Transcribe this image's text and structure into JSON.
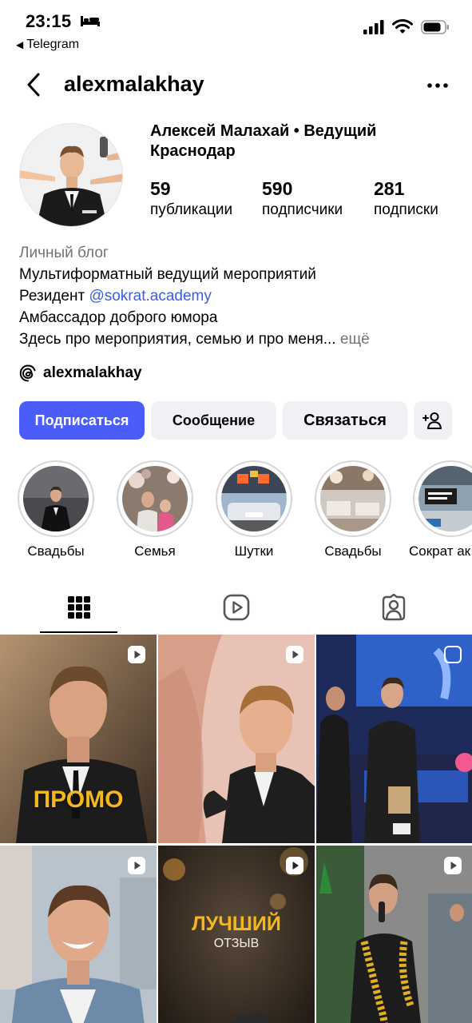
{
  "status": {
    "time": "23:15",
    "back_app": "Telegram"
  },
  "header": {
    "username": "alexmalakhay"
  },
  "profile": {
    "full_name": "Алексей Малахай • Ведущий Краснодар",
    "stats": [
      {
        "value": "59",
        "label": "публикации"
      },
      {
        "value": "590",
        "label": "подписчики"
      },
      {
        "value": "281",
        "label": "подписки"
      }
    ],
    "bio": {
      "category": "Личный блог",
      "line1": "Мультиформатный ведущий мероприятий",
      "line2_prefix": "Резидент",
      "line2_mention": "@sokrat.academy",
      "line3": "Амбассадор доброго юмора",
      "line4": "Здесь про мероприятия, семью и про меня...",
      "more": "ещё"
    },
    "threads_handle": "alexmalakhay"
  },
  "actions": {
    "follow": "Подписаться",
    "message": "Сообщение",
    "contact": "Связаться"
  },
  "highlights": [
    "Свадьбы",
    "Семья",
    "Шутки",
    "Свадьбы",
    "Сократ ак"
  ],
  "grid": {
    "promo_text": "ПРОМО",
    "best_text": "ЛУЧШИЙ",
    "review_text": "ОТЗЫВ"
  },
  "colors": {
    "follow_button": "#4a5df9",
    "mention": "#3a5ee0",
    "muted": "#737373",
    "button_bg": "#eff1f4"
  },
  "icons": [
    "back-icon",
    "more-icon",
    "threads-icon",
    "add-person-icon",
    "grid-icon",
    "reels-icon",
    "tagged-icon",
    "reel-badge-icon"
  ]
}
